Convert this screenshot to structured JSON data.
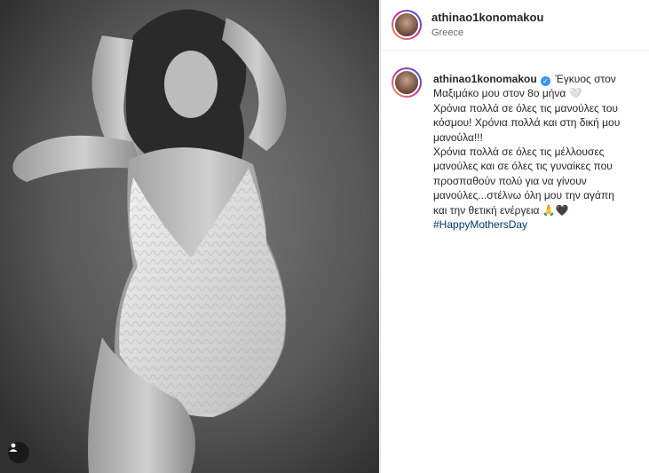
{
  "post": {
    "username": "athinao1konomakou",
    "location": "Greece"
  },
  "caption": {
    "username": "athinao1konomakou",
    "line1": "Έγκυος στον",
    "line2": "Μαξιμάκο μου στον 8ο μήνα 🤍",
    "line3": "Χρόνια πολλά σε όλες τις μανούλες του",
    "line4": "κόσμου! Χρόνια πολλά και στη δική μου",
    "line5": "μανούλα!!!",
    "line6": "Χρόνια πολλά σε όλες τις μέλλουσες",
    "line7": "μανούλες και σε όλες τις γυναίκες που",
    "line8": "προσπαθούν πολύ για να γίνουν",
    "line9": "μανούλες...στέλνω όλη μου την αγάπη",
    "line10": "και την θετική ενέργεια 🙏🖤",
    "hashtag": "#HappyMothersDay"
  },
  "icons": {
    "verified": "verified-badge-icon",
    "tagged_users": "user-tag-icon"
  },
  "colors": {
    "link": "#00376b",
    "verified": "#3897f0",
    "text": "#262626"
  }
}
